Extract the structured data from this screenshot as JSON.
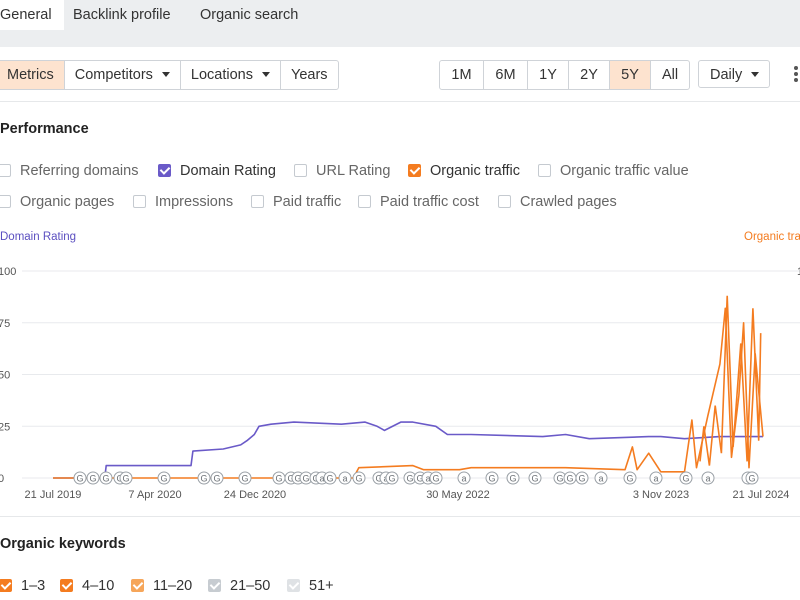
{
  "tabs": [
    {
      "label": "General",
      "active": true
    },
    {
      "label": "Backlink profile",
      "active": false
    },
    {
      "label": "Organic search",
      "active": false
    }
  ],
  "toolbar": {
    "view_tabs": [
      {
        "label": "Metrics",
        "selected": true
      },
      {
        "label": "Competitors",
        "dropdown": true
      },
      {
        "label": "Locations",
        "dropdown": true
      },
      {
        "label": "Years"
      }
    ],
    "ranges": [
      {
        "label": "1M"
      },
      {
        "label": "6M"
      },
      {
        "label": "1Y"
      },
      {
        "label": "2Y"
      },
      {
        "label": "5Y",
        "selected": true
      },
      {
        "label": "All"
      }
    ],
    "interval": "Daily",
    "more_icon": "kebab-menu-icon"
  },
  "performance": {
    "title": "Performance",
    "metrics": [
      {
        "label": "Referring domains",
        "checked": false
      },
      {
        "label": "Domain Rating",
        "checked": true,
        "color": "#6a5ac8"
      },
      {
        "label": "URL Rating",
        "checked": false
      },
      {
        "label": "Organic traffic",
        "checked": true,
        "color": "#f47c20"
      },
      {
        "label": "Organic traffic value",
        "checked": false
      },
      {
        "label": "Organic pages",
        "checked": false
      },
      {
        "label": "Impressions",
        "checked": false
      },
      {
        "label": "Paid traffic",
        "checked": false
      },
      {
        "label": "Paid traffic cost",
        "checked": false
      },
      {
        "label": "Crawled pages",
        "checked": false
      }
    ]
  },
  "chart_data": {
    "type": "line",
    "left_axis_label": "Domain Rating",
    "right_axis_label": "Organic tra",
    "y_ticks_left": [
      "100",
      "75",
      "50",
      "25",
      "0"
    ],
    "ylim_left": [
      0,
      100
    ],
    "x_tick_labels": [
      "21 Jul 2019",
      "7 Apr 2020",
      "24 Dec 2020",
      "30 May 2022",
      "3 Nov 2023",
      "21 Jul 2024"
    ],
    "grid": true,
    "series": [
      {
        "name": "Domain Rating",
        "color": "#6a5ac8",
        "points": [
          [
            "2019-07-21",
            0
          ],
          [
            "2019-12-01",
            0
          ],
          [
            "2019-12-05",
            6
          ],
          [
            "2020-07-10",
            6
          ],
          [
            "2020-07-15",
            13
          ],
          [
            "2020-10-01",
            14
          ],
          [
            "2020-11-15",
            16
          ],
          [
            "2020-12-01",
            18
          ],
          [
            "2020-12-20",
            21
          ],
          [
            "2021-01-01",
            25
          ],
          [
            "2021-02-01",
            26
          ],
          [
            "2021-04-01",
            27
          ],
          [
            "2021-08-01",
            26
          ],
          [
            "2021-10-01",
            27
          ],
          [
            "2021-11-01",
            25
          ],
          [
            "2021-11-20",
            23
          ],
          [
            "2022-01-01",
            27
          ],
          [
            "2022-02-01",
            27
          ],
          [
            "2022-04-01",
            25
          ],
          [
            "2022-05-01",
            21
          ],
          [
            "2022-07-01",
            21
          ],
          [
            "2023-01-01",
            20
          ],
          [
            "2023-03-01",
            21
          ],
          [
            "2023-05-01",
            19
          ],
          [
            "2023-10-01",
            20
          ],
          [
            "2023-11-01",
            20
          ],
          [
            "2024-01-01",
            19
          ],
          [
            "2024-04-01",
            20
          ],
          [
            "2024-07-21",
            20
          ]
        ]
      },
      {
        "name": "Organic traffic",
        "color": "#f47c20",
        "points": [
          [
            "2019-07-21",
            0
          ],
          [
            "2021-09-01",
            0
          ],
          [
            "2021-09-15",
            5
          ],
          [
            "2022-02-01",
            6
          ],
          [
            "2022-03-01",
            4
          ],
          [
            "2022-06-01",
            4
          ],
          [
            "2022-07-01",
            5
          ],
          [
            "2023-03-01",
            5
          ],
          [
            "2023-08-01",
            4
          ],
          [
            "2023-08-20",
            15
          ],
          [
            "2023-09-01",
            4
          ],
          [
            "2023-10-01",
            12
          ],
          [
            "2023-11-01",
            3
          ],
          [
            "2024-01-01",
            3
          ],
          [
            "2024-01-20",
            28
          ],
          [
            "2024-02-01",
            5
          ],
          [
            "2024-03-01",
            30
          ],
          [
            "2024-04-01",
            55
          ],
          [
            "2024-04-15",
            82
          ],
          [
            "2024-05-01",
            10
          ],
          [
            "2024-05-20",
            40
          ],
          [
            "2024-06-01",
            75
          ],
          [
            "2024-06-15",
            5
          ],
          [
            "2024-07-01",
            60
          ],
          [
            "2024-07-21",
            20
          ]
        ]
      }
    ],
    "event_markers": [
      "G",
      "G",
      "G",
      "G",
      "G",
      "G",
      "G",
      "G",
      "G",
      "G",
      "G",
      "G",
      "G",
      "G",
      "a",
      "G",
      "a",
      "G",
      "G",
      "a",
      "G",
      "G",
      "G",
      "a",
      "G",
      "a",
      "G",
      "G",
      "G",
      "G",
      "G",
      "G",
      "a",
      "G",
      "a",
      "G",
      "a",
      "2",
      "G"
    ]
  },
  "keywords": {
    "title": "Organic keywords",
    "ranges": [
      {
        "label": "1–3",
        "checked": true,
        "color": "#f47c20"
      },
      {
        "label": "4–10",
        "checked": true,
        "color": "#f47c20"
      },
      {
        "label": "11–20",
        "checked": true,
        "color": "#f6a65a"
      },
      {
        "label": "21–50",
        "checked": true,
        "color": "#c7ccd1"
      },
      {
        "label": "51+",
        "checked": true,
        "color": "#dfe2e5"
      }
    ]
  }
}
